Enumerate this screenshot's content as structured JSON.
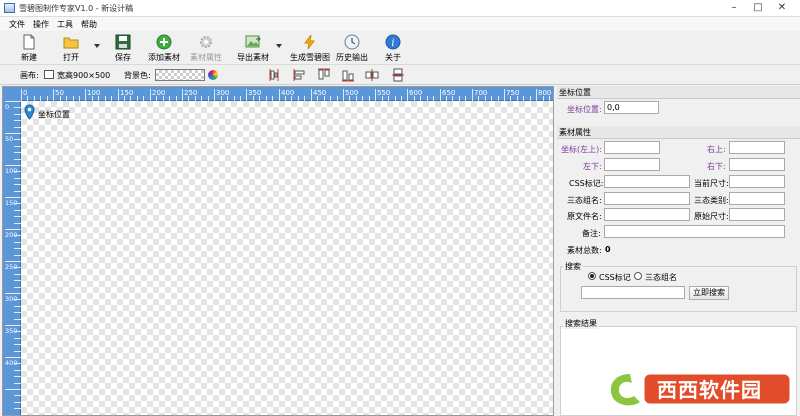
{
  "window": {
    "title": "雪碧图制作专家V1.0 - 新设计稿",
    "controls": [
      "minimize",
      "maximize",
      "close"
    ]
  },
  "menu": [
    "文件",
    "操作",
    "工具",
    "帮助"
  ],
  "toolbar": {
    "new": "新建",
    "open": "打开",
    "save": "保存",
    "add_material": "添加素材",
    "material_props": "素材属性",
    "export_material": "导出素材",
    "generate_sprite": "生成雪碧图",
    "history": "历史输出",
    "about": "关于"
  },
  "options": {
    "canvas_label": "画布:",
    "canvas_size": "宽高900×500",
    "bgcolor_label": "背景色:"
  },
  "ruler": {
    "h_ticks": [
      "0",
      "50",
      "100",
      "150",
      "200",
      "250",
      "300",
      "350",
      "400",
      "450",
      "500",
      "550",
      "600",
      "650",
      "700",
      "750",
      "800"
    ],
    "v_ticks": [
      "0",
      "50",
      "100",
      "150",
      "200",
      "250",
      "300",
      "350",
      "400"
    ]
  },
  "canvas": {
    "marker_label": "坐标位置"
  },
  "panel": {
    "position": {
      "header": "坐标位置",
      "label": "坐标位置:",
      "value": "0,0"
    },
    "props": {
      "header": "素材属性",
      "coord_top_left": "坐标(左上):",
      "top_right": "右上:",
      "bottom_left": "左下:",
      "bottom_right": "右下:",
      "css_mark": "CSS标记:",
      "current_size": "当前尺寸:",
      "tristate_group": "三态组名:",
      "tristate_type": "三态类别:",
      "orig_filename": "原文件名:",
      "orig_size": "原始尺寸:",
      "note": "备注:",
      "total_label": "素材总数:",
      "total_value": "0"
    },
    "search": {
      "header": "搜索",
      "opt_css": "CSS标记",
      "opt_group": "三态组名",
      "button": "立即搜索",
      "results_header": "搜索结果"
    }
  },
  "watermark": {
    "text": "西西软件园"
  },
  "colors": {
    "ruler_blue": "#5b97d6",
    "label_purple": "#7a3a9a"
  }
}
